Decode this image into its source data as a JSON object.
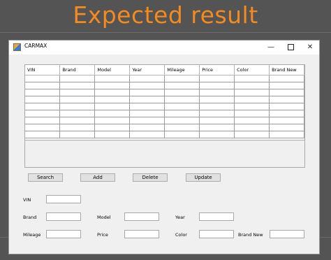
{
  "banner": {
    "text": "Expected result",
    "color": "#f58a1f"
  },
  "window": {
    "title": "CARMAX",
    "controls": {
      "minimize": "—",
      "maximize": "",
      "close": "✕"
    }
  },
  "table": {
    "columns": [
      "VIN",
      "Brand",
      "Model",
      "Year",
      "Mileage",
      "Price",
      "Color",
      "Brand New"
    ],
    "row_count": 9
  },
  "buttons": {
    "search": "Search",
    "add": "Add",
    "delete": "Delete",
    "update": "Update"
  },
  "form": {
    "vin_label": "VIN",
    "vin_value": "",
    "brand_label": "Brand",
    "brand_value": "",
    "model_label": "Model",
    "model_value": "",
    "year_label": "Year",
    "year_value": "",
    "mileage_label": "Mileage",
    "mileage_value": "",
    "price_label": "Price",
    "price_value": "",
    "color_label": "Color",
    "color_value": "",
    "brand_new_label": "Brand New",
    "brand_new_value": ""
  }
}
